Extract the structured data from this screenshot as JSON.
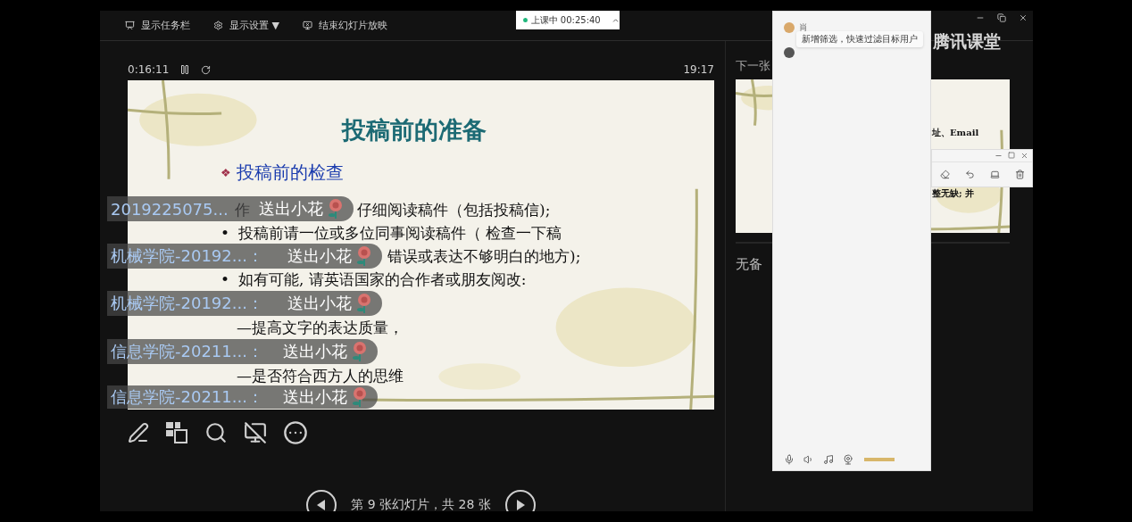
{
  "toolbar": {
    "items": [
      {
        "kind": "taskbar",
        "label": "显示任务栏"
      },
      {
        "kind": "settings",
        "label": "显示设置 ▼"
      },
      {
        "kind": "end",
        "label": "结束幻灯片放映"
      }
    ]
  },
  "app_title": "腾讯课堂",
  "class_status": {
    "label": "上课中 00:25:40"
  },
  "timer": {
    "elapsed": "0:16:11",
    "clock": "19:17"
  },
  "slide": {
    "title": "投稿前的准备",
    "subtitle_mark": "❖",
    "subtitle": "投稿前的检查",
    "lines": [
      {
        "kind": "bullet",
        "parts": [
          "作",
          "仔细阅读稿件（包括投稿信);"
        ]
      },
      {
        "kind": "bullet",
        "mark": "•",
        "parts": [
          "投稿前请一位或多位同事阅读稿件（ 检查一下稿"
        ]
      },
      {
        "kind": "continuation",
        "parts": [
          "错误或表达不够明白的地方);"
        ]
      },
      {
        "kind": "bullet",
        "mark": "•",
        "parts": [
          "如有可能, 请英语国家的合作者或朋友阅改:"
        ]
      },
      {
        "kind": "dash",
        "parts": [
          "—提高文字的表达质量，"
        ]
      },
      {
        "kind": "dash",
        "parts": [
          "—是否符合西方人的思维"
        ]
      }
    ]
  },
  "gifts": [
    {
      "sender": "2019225075...",
      "message": "送出小花"
    },
    {
      "sender": "机械学院-20192...：",
      "message": "送出小花"
    },
    {
      "sender": "机械学院-20192...：",
      "message": "送出小花"
    },
    {
      "sender": "信息学院-20211...：",
      "message": "送出小花"
    },
    {
      "sender": "信息学院-20211...：",
      "message": "送出小花"
    }
  ],
  "slide_nav": {
    "label": "第 9 张幻灯片，共 28 张"
  },
  "next_slide": {
    "heading": "下一张",
    "lines": [
      "址、Email",
      "整无缺; 并"
    ]
  },
  "notes": "无备",
  "chat": {
    "members": [
      {
        "name": "肖"
      }
    ],
    "tooltip": "新增筛选，快速过滤目标用户"
  }
}
